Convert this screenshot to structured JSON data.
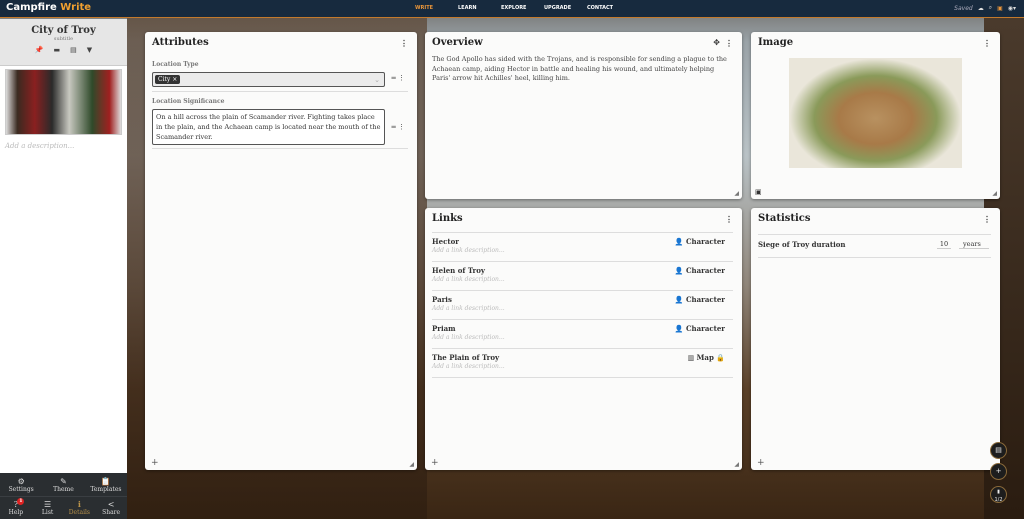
{
  "nav": {
    "logo_a": "Campfire",
    "logo_b": "Write",
    "links": [
      "WRITE",
      "LEARN",
      "EXPLORE",
      "UPGRADE",
      "CONTACT"
    ],
    "saved": "Saved"
  },
  "sidebar": {
    "title": "City of Troy",
    "subtitle": "subtitle",
    "description_placeholder": "Add a description...",
    "footer": [
      {
        "label": "Settings",
        "icon": "⚙"
      },
      {
        "label": "Theme",
        "icon": "✎"
      },
      {
        "label": "Templates",
        "icon": "📋"
      },
      {
        "label": "Help",
        "icon": "?",
        "badge": "1"
      },
      {
        "label": "List",
        "icon": "☰"
      },
      {
        "label": "Details",
        "icon": "ℹ"
      },
      {
        "label": "Share",
        "icon": "<"
      }
    ]
  },
  "attributes": {
    "title": "Attributes",
    "location_type_label": "Location Type",
    "location_type_value": "City",
    "significance_label": "Location Significance",
    "significance_value": "On a hill across the plain of Scamander river. Fighting takes place in the plain, and the Achaean camp is located near the mouth of the Scamander river."
  },
  "overview": {
    "title": "Overview",
    "text": "The God Apollo has sided with the Trojans, and is responsible for sending a plague to the Achaean camp, aiding Hector in battle and healing his wound, and ultimately helping Paris' arrow hit Achilles' heel, killing him."
  },
  "image": {
    "title": "Image"
  },
  "links": {
    "title": "Links",
    "placeholder": "Add a link description...",
    "items": [
      {
        "name": "Hector",
        "type": "Character",
        "icon": "person-icon"
      },
      {
        "name": "Helen of Troy",
        "type": "Character",
        "icon": "person-icon"
      },
      {
        "name": "Paris",
        "type": "Character",
        "icon": "person-icon"
      },
      {
        "name": "Priam",
        "type": "Character",
        "icon": "person-icon"
      },
      {
        "name": "The Plain of Troy",
        "type": "Map",
        "icon": "map-icon",
        "locked": true
      }
    ]
  },
  "statistics": {
    "title": "Statistics",
    "items": [
      {
        "name": "Siege of Troy duration",
        "value": "10",
        "unit": "years"
      }
    ]
  },
  "fabs": {
    "page": "1/2"
  },
  "colors": {
    "nav": "#172a3e",
    "accent": "#e9953a"
  }
}
